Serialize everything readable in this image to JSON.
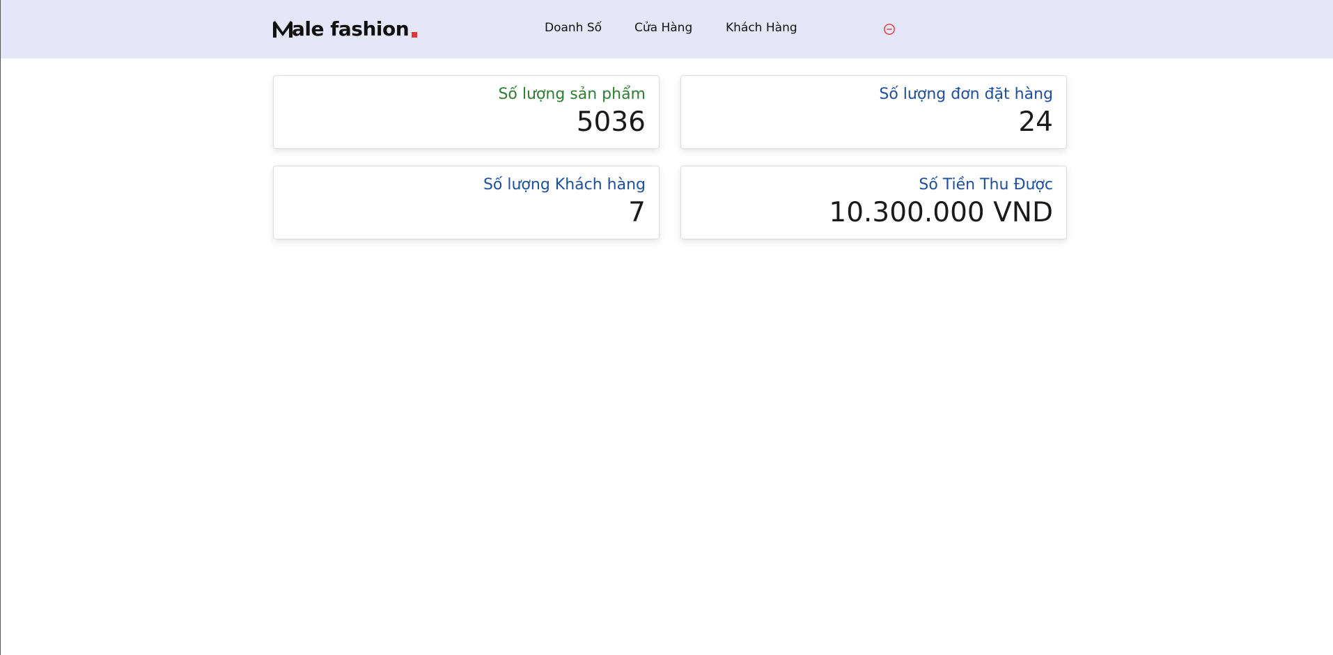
{
  "brand": {
    "name": "ale fashion",
    "accent_color": "#e53637",
    "logo_icon": "brand-m-icon"
  },
  "nav": {
    "items": [
      {
        "label": "Doanh Số"
      },
      {
        "label": "Cửa Hàng"
      },
      {
        "label": "Khách Hàng"
      }
    ],
    "logout_icon": "minus-circle-icon",
    "logout_color": "#e53637"
  },
  "header": {
    "background": "#e5e6f7"
  },
  "stats": [
    {
      "label": "Số lượng sản phẩm",
      "value": "5036",
      "label_color": "#2e7d32"
    },
    {
      "label": "Số lượng đơn đặt hàng",
      "value": "24",
      "label_color": "#1f4e9a"
    },
    {
      "label": "Số lượng Khách hàng",
      "value": "7",
      "label_color": "#1f4e9a"
    },
    {
      "label": "Số Tiền Thu Được",
      "value": "10.300.000 VND",
      "label_color": "#1f4e9a"
    }
  ]
}
